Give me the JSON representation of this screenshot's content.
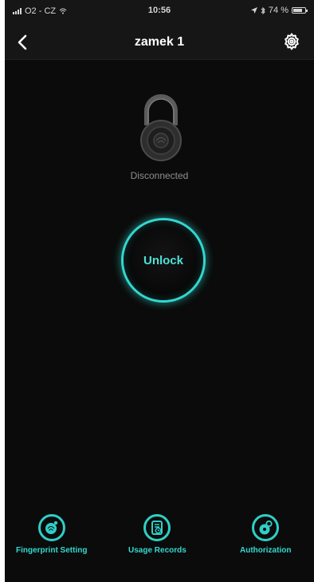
{
  "status_bar": {
    "carrier": "O2 - CZ",
    "time": "10:56",
    "battery": "74 %"
  },
  "header": {
    "title": "zamek 1",
    "back_icon": "chevron-left-icon",
    "settings_icon": "gear-icon"
  },
  "lock": {
    "icon": "padlock-icon",
    "status": "Disconnected"
  },
  "unlock_button": {
    "label": "Unlock"
  },
  "actions": [
    {
      "label": "Fingerprint Setting",
      "icon": "fingerprint-icon"
    },
    {
      "label": "Usage Records",
      "icon": "usage-records-icon"
    },
    {
      "label": "Authorization",
      "icon": "authorization-icon"
    }
  ],
  "colors": {
    "accent": "#32d7cf",
    "background": "#0b0b0b",
    "header": "#161616",
    "text_muted": "#8e8e8e"
  }
}
